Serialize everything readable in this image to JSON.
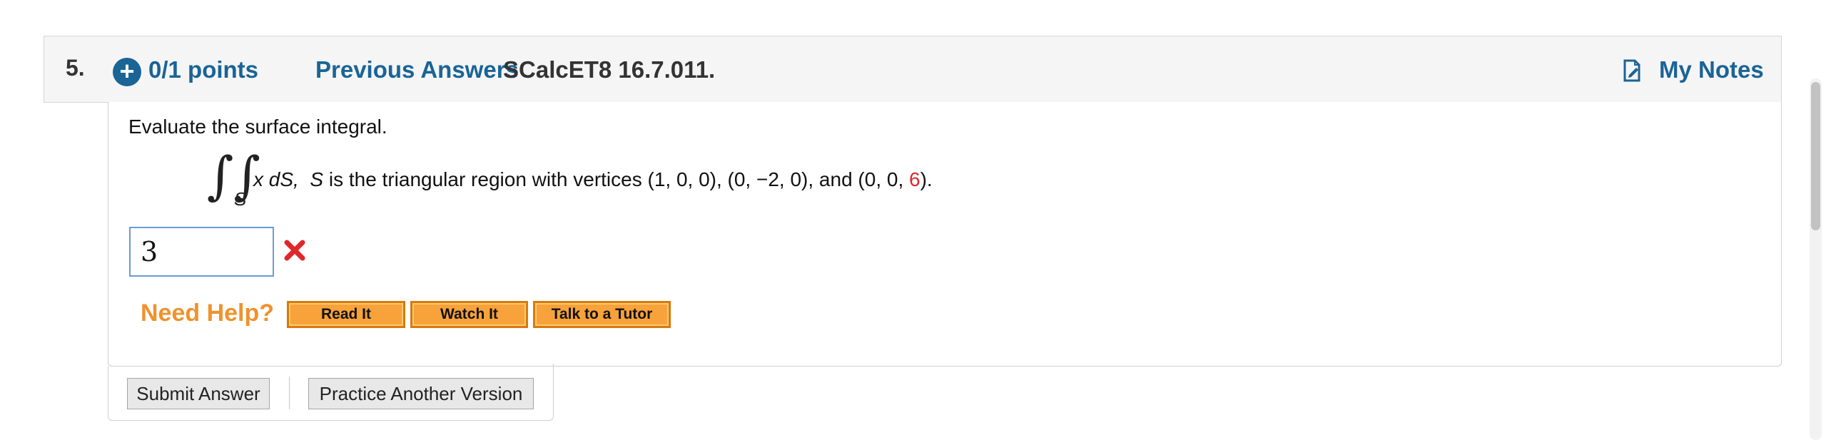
{
  "question": {
    "number": "5.",
    "points": "0/1 points",
    "previous_answers": "Previous Answers",
    "code": "SCalcET8 16.7.011.",
    "my_notes": "My Notes"
  },
  "prompt": "Evaluate the surface integral.",
  "formula": {
    "integral_symbol": "∫∫",
    "subscript": "S",
    "integrand": "x dS,",
    "surface": "S",
    "text_before_red": " is the triangular region with vertices (1, 0, 0), (0, −2, 0), and (0, 0, ",
    "red_value": "6",
    "text_after_red": ")."
  },
  "answer": {
    "value": "3",
    "status": "incorrect"
  },
  "help": {
    "label": "Need Help?",
    "read_it": "Read It",
    "watch_it": "Watch It",
    "talk_to_tutor": "Talk to a Tutor"
  },
  "actions": {
    "submit": "Submit Answer",
    "practice": "Practice Another Version"
  },
  "colors": {
    "link_blue": "#1a6496",
    "need_help_orange": "#f0922d",
    "button_orange": "#f7a23a",
    "incorrect_red": "#e0272a"
  }
}
